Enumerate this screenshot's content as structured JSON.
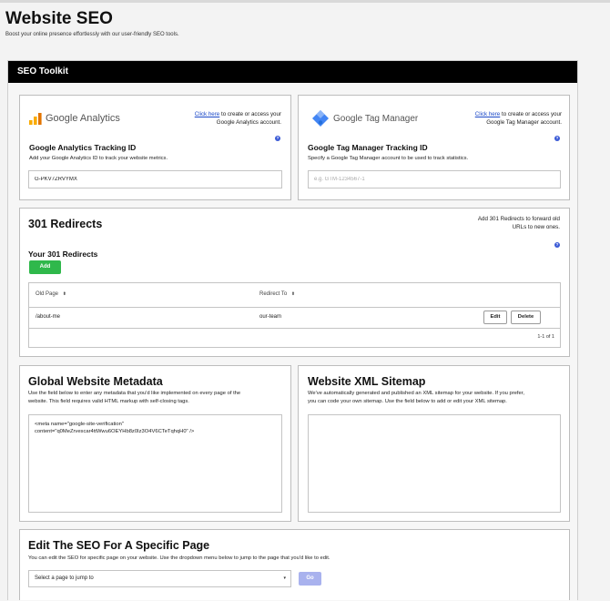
{
  "page": {
    "title": "Website SEO",
    "subtitle": "Boost your online presence effortlessly with our user-friendly SEO tools."
  },
  "toolkit": {
    "header": "SEO Toolkit"
  },
  "google_analytics": {
    "brand": "Google Analytics",
    "link_text": "Click here",
    "link_rest_line1": " to create or access your",
    "link_rest_line2": "Google Analytics account.",
    "field_title": "Google Analytics Tracking ID",
    "field_desc": "Add your Google Analytics ID to track your website metrics.",
    "value": "G-PKV7ZRVYMX",
    "help_icon": "help-icon"
  },
  "google_tag_manager": {
    "brand": "Google Tag Manager",
    "link_text": "Click here",
    "link_rest_line1": " to create or access your",
    "link_rest_line2": "Google Tag Manager account.",
    "field_title": "Google Tag Manager Tracking ID",
    "field_desc": "Specify a Google Tag Manager account to be used to track statistics.",
    "placeholder": "e.g. GTM-1234567-1",
    "help_icon": "help-icon"
  },
  "redirects": {
    "title": "301 Redirects",
    "note_line1": "Add 301 Redirects to forward old",
    "note_line2": "URLs to new ones.",
    "subtitle": "Your 301 Redirects",
    "add_label": "Add",
    "columns": [
      "Old Page",
      "Redirect To"
    ],
    "sort_icon": "⬍",
    "rows": [
      {
        "old_page": "/about-me",
        "redirect_to": "our-team",
        "edit_label": "Edit",
        "delete_label": "Delete"
      }
    ],
    "pagination": "1-1 of 1"
  },
  "metadata": {
    "title": "Global Website Metadata",
    "desc_line1": "Use the field below to enter any metadata that you'd like implemented on every page of the",
    "desc_line2": "website. This field requires valid HTML markup with self-closing tags.",
    "value": "<meta name=\"google-site-verification\"\ncontent=\"q0MeZrvescar4ttWwu6OEYHb8z0Iz3O4V6CTeTqhqH0\" />"
  },
  "sitemap": {
    "title": "Website XML Sitemap",
    "desc_line1": "We've automatically generated and published an XML sitemap for your website. If you prefer,",
    "desc_line2": "you can code your own sitemap. Use the field below to add or edit your XML sitemap.",
    "value": ""
  },
  "page_seo": {
    "title": "Edit The SEO For A Specific Page",
    "desc": "You can edit the SEO for specific page on your website. Use the dropdown menu below to jump to the page that you'd like to edit.",
    "select_value": "Select a page to jump to",
    "go_label": "Go"
  },
  "colors": {
    "header_bg": "#000000",
    "add_button": "#2fb84b",
    "go_button": "#a9b2ee",
    "link": "#1a48c8",
    "help_icon": "#3a5ad6"
  }
}
